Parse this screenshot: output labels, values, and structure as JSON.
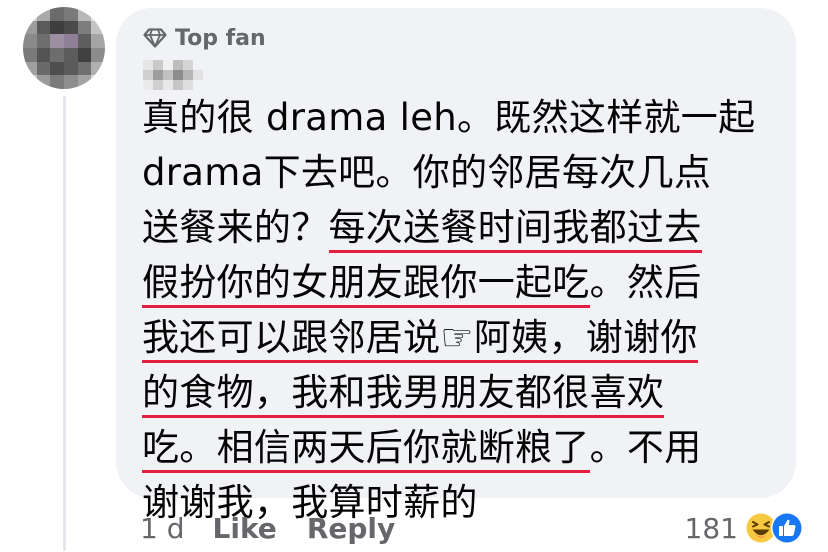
{
  "comment": {
    "badge_label": "Top fan",
    "author_name": "[blurred]",
    "body_lines": [
      [
        {
          "text": "真的很 drama leh。既然这样就一起",
          "u": false
        }
      ],
      [
        {
          "text": "drama下去吧。你的邻居每次几点",
          "u": false
        }
      ],
      [
        {
          "text": "送餐来的？",
          "u": false
        },
        {
          "text": "每次送餐时间我都过去",
          "u": true
        }
      ],
      [
        {
          "text": "假扮你的女朋友跟你一起吃",
          "u": true
        },
        {
          "text": "。然后",
          "u": false
        }
      ],
      [
        {
          "text": "我还可以跟邻居说☞阿姨，谢谢你",
          "u": true
        }
      ],
      [
        {
          "text": "的食物，我和我男朋友都很喜欢",
          "u": true
        }
      ],
      [
        {
          "text": "吃。相信两天后你就断粮了",
          "u": true
        },
        {
          "text": "。不用",
          "u": false
        }
      ],
      [
        {
          "text": "谢谢我，我算时薪的",
          "u": false
        }
      ]
    ],
    "timestamp": "1 d",
    "like_label": "Like",
    "reply_label": "Reply",
    "reaction_count": "181",
    "reaction_icons": [
      "laugh-emoji",
      "like-thumb"
    ],
    "colors": {
      "bubble_bg": "#f0f2f5",
      "secondary_text": "#65676b",
      "underline": "#e41e3f",
      "like_blue": "#1877f2"
    }
  }
}
